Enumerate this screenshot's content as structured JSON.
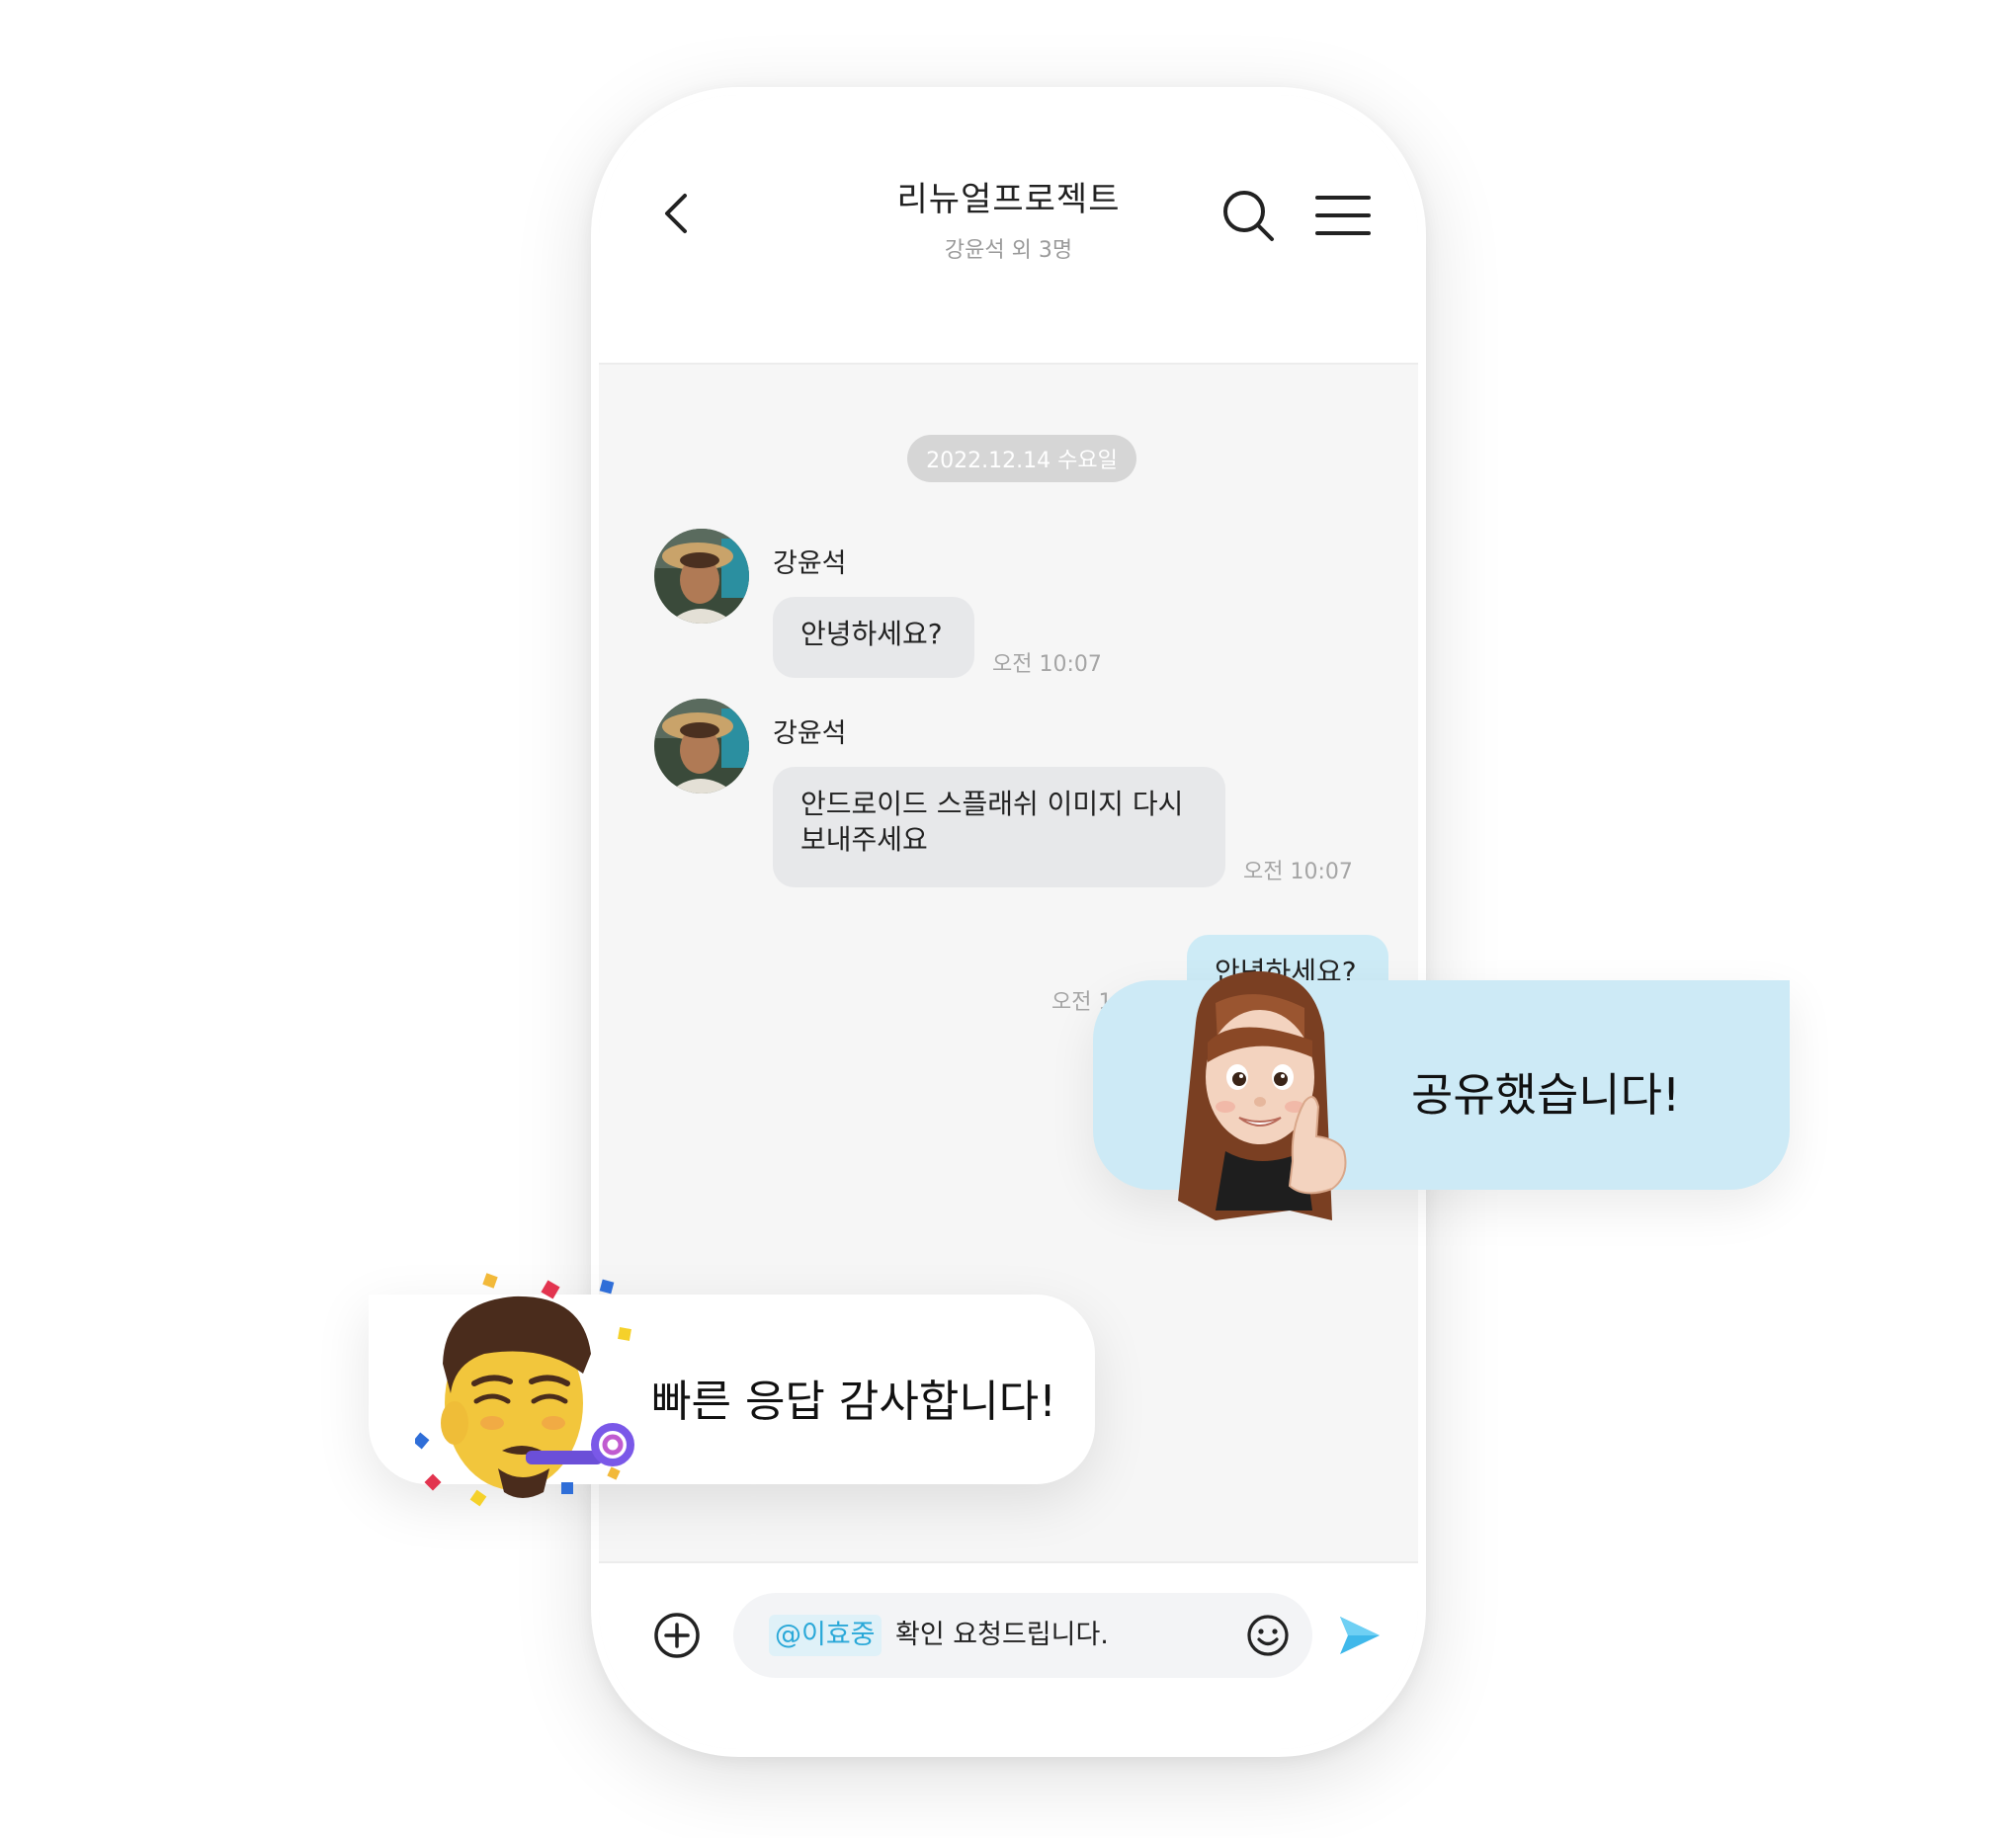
{
  "header": {
    "title": "리뉴얼프로젝트",
    "subtitle": "강윤석 외 3명",
    "icons": {
      "back": "chevron-left-icon",
      "search": "search-icon",
      "menu": "hamburger-menu-icon"
    }
  },
  "date_divider": "2022.12.14 수요일",
  "messages": [
    {
      "sender": "강윤석",
      "text": "안녕하세요?",
      "time": "오전 10:07",
      "direction": "incoming"
    },
    {
      "sender": "강윤석",
      "text_line1": "안드로이드 스플래쉬 이미지 다시",
      "text_line2": "보내주세요",
      "time": "오전 10:07",
      "direction": "incoming"
    },
    {
      "text": "안녕하세요?",
      "time": "오전 10:07",
      "direction": "outgoing"
    }
  ],
  "floating": {
    "shared": "공유했습니다!",
    "thanks": "빠른 응답 감사합니다!"
  },
  "composer": {
    "mention": "@이효중",
    "text": "확인 요청드립니다.",
    "icons": {
      "attach": "plus-circle-icon",
      "emoji": "smiley-icon",
      "send": "send-arrow-icon"
    }
  },
  "colors": {
    "incoming_bubble": "#e7e8ea",
    "outgoing_bubble": "#cdebf6",
    "accent": "#2aa8d8",
    "send_icon": "#3fb8ea",
    "date_pill": "#d6d6d6"
  }
}
